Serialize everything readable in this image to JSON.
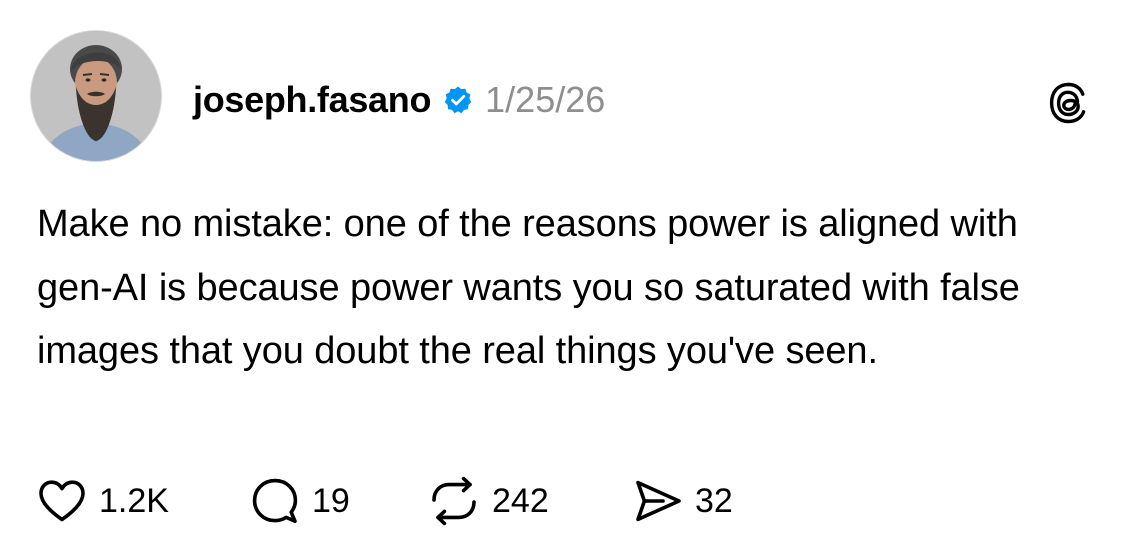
{
  "post": {
    "username": "joseph.fasano",
    "verified": true,
    "timestamp": "1/25/26",
    "text": "Make no mistake: one of the reasons power is aligned with gen-AI is because power wants you so saturated with false images that you doubt the real things you've seen.",
    "platform_icon": "threads-logo-icon"
  },
  "actions": {
    "likes": "1.2K",
    "replies": "19",
    "reposts": "242",
    "shares": "32"
  },
  "icons": {
    "like": "heart-icon",
    "reply": "speech-bubble-icon",
    "repost": "repost-arrows-icon",
    "share": "paper-plane-icon",
    "verified": "verified-badge-icon"
  },
  "colors": {
    "verified_badge": "#0095f6",
    "timestamp": "#8e8e8e",
    "text": "#000000",
    "background": "#ffffff"
  }
}
